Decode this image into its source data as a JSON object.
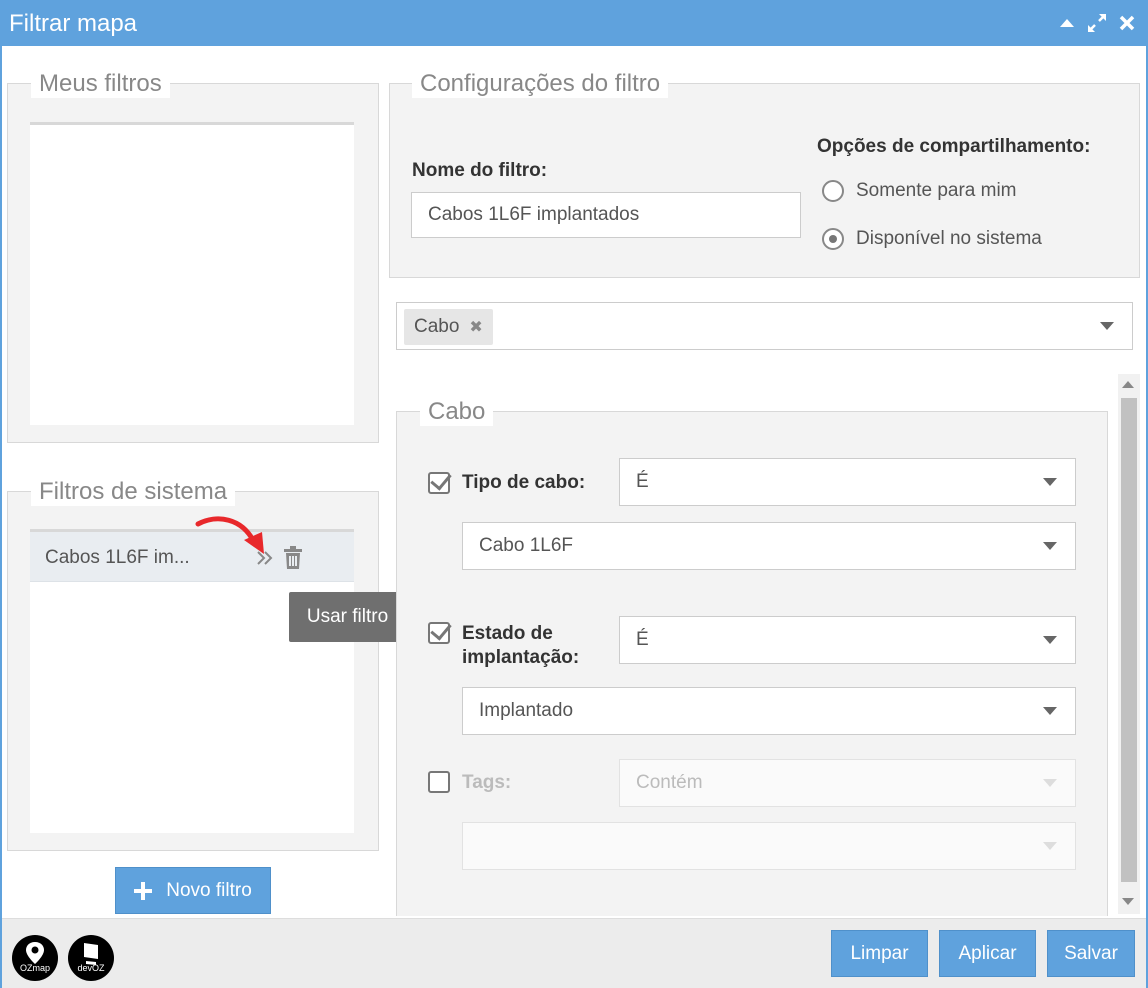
{
  "window": {
    "title": "Filtrar mapa"
  },
  "my_filters": {
    "legend": "Meus filtros"
  },
  "system_filters": {
    "legend": "Filtros de sistema",
    "items": [
      {
        "label": "Cabos 1L6F im..."
      }
    ]
  },
  "tooltip": {
    "text": "Usar filtro"
  },
  "new_filter_button": {
    "label": "Novo filtro"
  },
  "config": {
    "legend": "Configurações do filtro",
    "name_label": "Nome do filtro:",
    "name_value": "Cabos 1L6F implantados",
    "sharing_label": "Opções de compartilhamento:",
    "sharing_options": [
      {
        "label": "Somente para mim",
        "selected": false
      },
      {
        "label": "Disponível no sistema",
        "selected": true
      }
    ]
  },
  "entity_select": {
    "tags": [
      {
        "label": "Cabo",
        "remove": "✖"
      }
    ]
  },
  "cabo_section": {
    "legend": "Cabo",
    "criteria": [
      {
        "label": "Tipo de cabo:",
        "checked": true,
        "operator": "É",
        "value": "Cabo 1L6F"
      },
      {
        "label_line1": "Estado de",
        "label_line2": "implantação:",
        "checked": true,
        "operator": "É",
        "value": "Implantado"
      },
      {
        "label": "Tags:",
        "checked": false,
        "operator": "Contém",
        "value": ""
      }
    ]
  },
  "footer": {
    "logos": [
      {
        "text": "OZmap"
      },
      {
        "text": "devOZ"
      }
    ],
    "buttons": {
      "clear": "Limpar",
      "apply": "Aplicar",
      "save": "Salvar"
    }
  },
  "colors": {
    "accent": "#5fa2dd",
    "annotation_arrow": "#e8282b"
  }
}
